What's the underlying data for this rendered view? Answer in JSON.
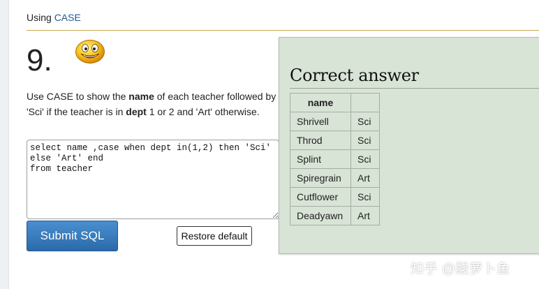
{
  "breadcrumb": {
    "prefix": "Using ",
    "link": "CASE"
  },
  "question": {
    "number": "9.",
    "smiley": "smiley-face-icon",
    "text_parts": [
      "Use CASE to show the ",
      "name",
      " of each teacher followed by 'Sci' if the teacher is in ",
      "dept",
      " 1 or 2 and 'Art' otherwise."
    ]
  },
  "editor": {
    "value": "select name ,case when dept in(1,2) then 'Sci' else 'Art' end\nfrom teacher"
  },
  "buttons": {
    "submit": "Submit SQL",
    "restore": "Restore default"
  },
  "answer": {
    "title": "Correct answer",
    "columns": [
      "name",
      ""
    ],
    "rows": [
      [
        "Shrivell",
        "Sci"
      ],
      [
        "Throd",
        "Sci"
      ],
      [
        "Splint",
        "Sci"
      ],
      [
        "Spiregrain",
        "Art"
      ],
      [
        "Cutflower",
        "Sci"
      ],
      [
        "Deadyawn",
        "Art"
      ]
    ]
  },
  "watermark": "知乎 @酸萝卜鱼",
  "colors": {
    "accent_link": "#1f5a97",
    "rule_gold": "#c8a951",
    "submit_blue": "#2b6aa9",
    "panel_green": "#d8e4d6"
  }
}
